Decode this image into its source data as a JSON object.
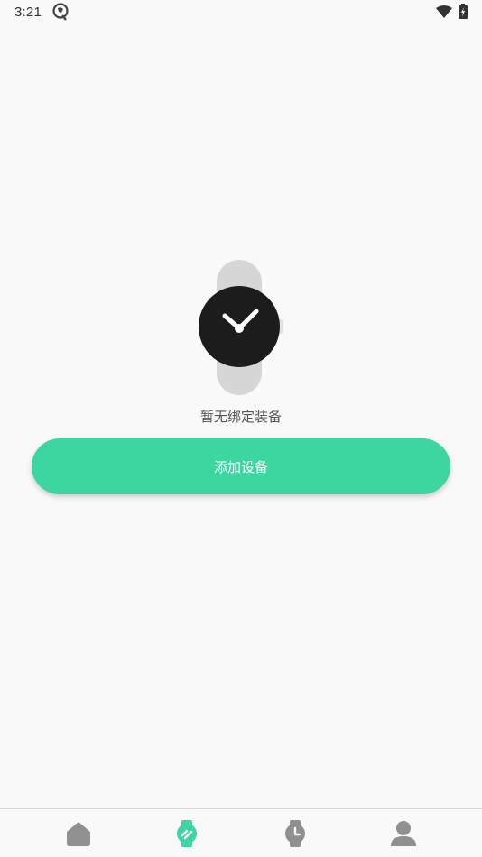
{
  "status_bar": {
    "time": "3:21"
  },
  "empty_state": {
    "message": "暂无绑定装备",
    "add_button_label": "添加设备"
  },
  "bottom_nav": {
    "items": [
      {
        "icon": "home-icon",
        "active": false
      },
      {
        "icon": "device-icon",
        "active": true
      },
      {
        "icon": "watch-icon",
        "active": false
      },
      {
        "icon": "profile-icon",
        "active": false
      }
    ]
  },
  "colors": {
    "accent": "#3dd5a0",
    "inactive_icon": "#909090",
    "background": "#f9f9f9"
  }
}
